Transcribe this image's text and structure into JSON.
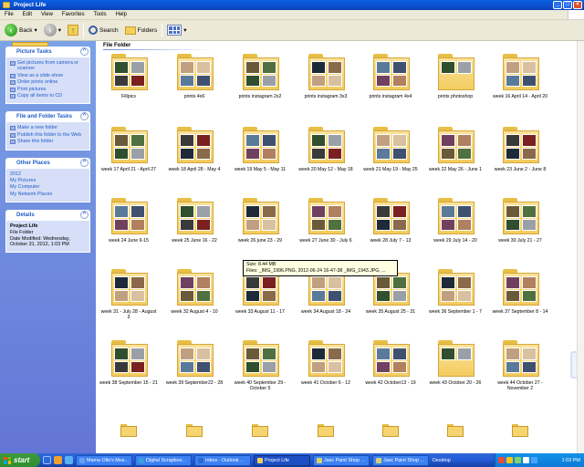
{
  "window": {
    "title": "Project Life"
  },
  "menu": [
    "File",
    "Edit",
    "View",
    "Favorites",
    "Tools",
    "Help"
  ],
  "toolbar": {
    "back": "Back",
    "search": "Search",
    "folders": "Folders"
  },
  "left_pane": {
    "picture_tasks": {
      "title": "Picture Tasks",
      "items": [
        "Get pictures from camera or scanner",
        "View as a slide show",
        "Order prints online",
        "Print pictures",
        "Copy all items to CD"
      ]
    },
    "file_folder_tasks": {
      "title": "File and Folder Tasks",
      "items": [
        "Make a new folder",
        "Publish this folder to the Web",
        "Share this folder"
      ]
    },
    "other_places": {
      "title": "Other Places",
      "items": [
        "2012",
        "My Pictures",
        "My Computer",
        "My Network Places"
      ]
    },
    "details": {
      "title": "Details",
      "name": "Project Life",
      "type": "File Folder",
      "modified": "Date Modified: Wednesday, October 31, 2012, 1:03 PM"
    }
  },
  "main": {
    "section_title": "File Folder",
    "folders": [
      "Fillpics",
      "prints 4x6",
      "prints instagram 2x2",
      "prints instagram 3x3",
      "prints instagram 4x4",
      "prints photoshop",
      "week 16 April 14 - April 20",
      "week 17 April 21 - April 27",
      "week 18 April 28 - May 4",
      "week 19 May 5 - May 11",
      "week 20 May 12 - May 18",
      "week 21 May 19 - May 25",
      "week 22 May 26 - June 1",
      "week 23 June 2 - June 8",
      "week 24 June 9-15",
      "week 25 June 16 - 22",
      "week 26 june 23 - 29",
      "week 27 June 30 - July 6",
      "week 28 July 7 - 13",
      "week 29 July 14 - 20",
      "week 30 July 21 - 27",
      "week 31 - July 28 - August 3",
      "week 32 August 4 - 10",
      "week 33 August 11 - 17",
      "week 34 August 18 - 24",
      "week 35 August 25 - 31",
      "week 36 September 1 - 7",
      "week 37 September 8 - 14",
      "week 38 September 15 - 21",
      "week 39 September22 - 28",
      "week 40 September 29 - October 5",
      "week 41 October 6 - 12",
      "week 42 October13 - 19",
      "week 43 October 20 - 26",
      "week 44 October 27 - November 2",
      "",
      "",
      "",
      "",
      "",
      "",
      ""
    ],
    "tooltip": {
      "size": "Size: 8.44 MB",
      "files": "Files: _IMG_1996.PNG, 2012-06-24 16-47-38 _IMG_1943.JPG, ..."
    }
  },
  "taskbar": {
    "start": "start",
    "tasks": [
      "Mama Olle's Mus...",
      "Digital Scrapboo...",
      "Inbox - Outlook ...",
      "Project Life",
      "Jasc Paint Shop ...",
      "Jasc Paint Shop ..."
    ],
    "active_task": "Project Life",
    "desktop": "Desktop",
    "clock": "1:03 PM"
  }
}
